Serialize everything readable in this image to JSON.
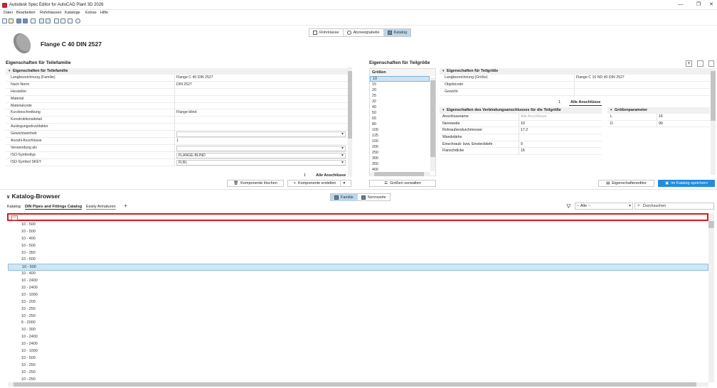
{
  "window": {
    "title": "Autodesk Spec Editor for AutoCAD Plant 3D 2026",
    "minimize": "—",
    "maximize": "❐",
    "close": "✕"
  },
  "menu": [
    "Datei",
    "Bearbeiten",
    "Rohrklassen",
    "Kataloge",
    "Extras",
    "Hilfe"
  ],
  "view_switch": {
    "rohrklasse": "Rohrklasse",
    "abzweig": "Abzweigtabelle",
    "katalog": "Katalog"
  },
  "part": {
    "title": "Flange C 40 DIN 2527"
  },
  "family_panel": {
    "section_title": "Eigenschaften für Teilefamilie",
    "group_title": "Eigenschaften für Teilefamilie",
    "rows": [
      {
        "k": "Langbezeichnung (Familie)",
        "v": "Flange C 40 DIN 2527"
      },
      {
        "k": "Nach Norm",
        "v": "DIN 2527"
      },
      {
        "k": "Hersteller",
        "v": ""
      },
      {
        "k": "Material",
        "v": ""
      },
      {
        "k": "Materialcode",
        "v": ""
      },
      {
        "k": "Kurzbeschreibung",
        "v": "Flange blind"
      },
      {
        "k": "Konstruktionsdetail",
        "v": ""
      },
      {
        "k": "Auslegungsdruckfaktor",
        "v": ""
      },
      {
        "k": "Gewichtseinheit",
        "v": "",
        "dd": true
      },
      {
        "k": "Anzahl Anschlüsse",
        "v": "1"
      },
      {
        "k": "Verwendung als",
        "v": "",
        "dd": true
      },
      {
        "k": "ISO-Symboltyp",
        "v": "FLANGE-BLIND",
        "dd": true
      },
      {
        "k": "ISO-Symbol SKEY",
        "v": "FLBL",
        "dd": true
      }
    ],
    "conn_count": "1",
    "all_conn": "Alle Anschlüsse",
    "delete_btn": "Komponente löschen",
    "create_btn": "Komponente erstellen"
  },
  "size_panel": {
    "section_title": "Eigenschaften für Teilgröße",
    "sizes_title": "Größen",
    "sizes": [
      "10",
      "15",
      "20",
      "25",
      "32",
      "40",
      "50",
      "65",
      "80",
      "100",
      "125",
      "150",
      "200",
      "250",
      "300",
      "350",
      "400"
    ],
    "group_title": "Eigenschaften für Teilgröße",
    "rows": [
      {
        "k": "Langbezeichnung (Größe)",
        "v": "Flange C 10 ND 40 DIN 2527"
      },
      {
        "k": "Objektcode",
        "v": ""
      },
      {
        "k": "Gewicht",
        "v": ""
      }
    ],
    "conn_count": "1",
    "all_conn": "Alle Anschlüsse",
    "conn_group_title": "Eigenschaften des Verbindungsanschlusses für die Teilgröße",
    "conn_rows": [
      {
        "k": "Anschlussname",
        "v": "Alle Anschlüsse"
      },
      {
        "k": "Nennweite",
        "v": "10"
      },
      {
        "k": "Rohraußendurchmesser",
        "v": "17.2"
      },
      {
        "k": "Wandstärke",
        "v": ""
      },
      {
        "k": "Einschraub- bzw. Einstecktiefe",
        "v": "0"
      },
      {
        "k": "Flanschdicke",
        "v": "16"
      }
    ],
    "param_group_title": "Größenparameter",
    "params": [
      {
        "k": "L",
        "v": "16"
      },
      {
        "k": "D",
        "v": "90"
      }
    ],
    "manage_sizes_btn": "Größen verwalten",
    "prop_editor_btn": "Eigenschafteneditor",
    "save_btn": "Im Katalog speichern"
  },
  "catalog_browser": {
    "title": "Katalog-Browser",
    "family_btn": "Familie",
    "nominal_btn": "Nennweite",
    "catalog_label": "Katalog:",
    "tabs": [
      "DIN Pipes and Fittings Catalog",
      "Essity Armaturen"
    ],
    "add": "+",
    "filter_value": "-- Alle --",
    "search_placeholder": "Durchsuchen",
    "rows": [
      "10 - 500",
      "10 - 500",
      "10 - 400",
      "10 - 500",
      "10 - 350",
      "10 - 500",
      "10 - 500",
      "10 - 400",
      "10 - 2400",
      "10 - 2400",
      "10 - 1000",
      "10 - 200",
      "10 - 250",
      "10 - 250",
      "6 - 2000",
      "10 - 300",
      "10 - 2400",
      "10 - 2400",
      "10 - 1000",
      "10 - 500",
      "10 - 250",
      "10 - 250",
      "10 - 250"
    ],
    "selected_index": 6
  },
  "colors": {
    "accent": "#1f8ce0",
    "highlight_border": "#e0161e",
    "selection": "#cfe6f4"
  }
}
